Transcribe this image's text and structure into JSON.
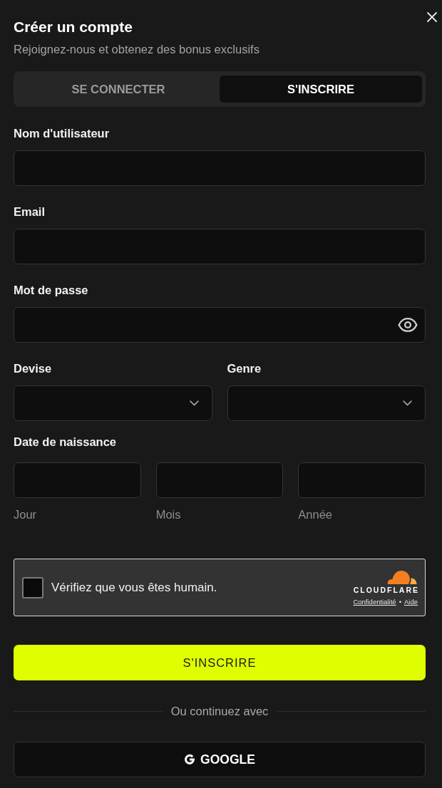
{
  "header": {
    "title": "Créer un compte",
    "subtitle": "Rejoignez-nous et obtenez des bonus exclusifs"
  },
  "tabs": [
    {
      "label": "SE CONNECTER",
      "selected": false
    },
    {
      "label": "S'INSCRIRE",
      "selected": true
    }
  ],
  "fields": [
    {
      "label": "Nom d'utilisateur",
      "kind": "text"
    },
    {
      "label": "Email",
      "kind": "text"
    },
    {
      "label": "Mot de passe",
      "kind": "password"
    }
  ],
  "selects": [
    {
      "label": "Devise"
    },
    {
      "label": "Genre"
    }
  ],
  "birth_date": {
    "label": "Date de naissance",
    "parts": [
      {
        "caption": "Jour"
      },
      {
        "caption": "Mois"
      },
      {
        "caption": "Année"
      }
    ]
  },
  "captcha": {
    "text": "Vérifiez que vous êtes humain.",
    "checked": false,
    "brand": "CLOUDFLARE",
    "links": [
      "Confidentialité",
      "Aide"
    ],
    "separator": "•"
  },
  "submit": {
    "label": "S'INSCRIRE"
  },
  "divider": {
    "text": "Ou continuez avec"
  },
  "social": [
    {
      "label": "GOOGLE"
    }
  ]
}
